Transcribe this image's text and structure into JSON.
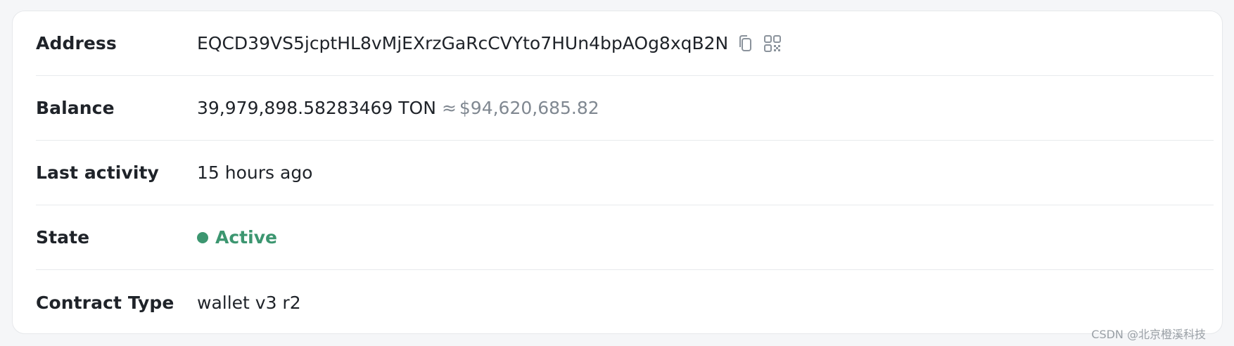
{
  "rows": {
    "address": {
      "label": "Address",
      "value": "EQCD39VS5jcptHL8vMjEXrzGaRcCVYto7HUn4bpAOg8xqB2N",
      "icons": [
        "copy-icon",
        "qr-code-icon"
      ]
    },
    "balance": {
      "label": "Balance",
      "ton": "39,979,898.58283469 TON",
      "approx": "≈",
      "usd": "$94,620,685.82"
    },
    "last_activity": {
      "label": "Last activity",
      "value": "15 hours ago"
    },
    "state": {
      "label": "State",
      "value": "Active",
      "color": "#3c9670"
    },
    "contract_type": {
      "label": "Contract Type",
      "value": "wallet v3 r2"
    }
  },
  "watermark": "CSDN @北京橙溪科技"
}
